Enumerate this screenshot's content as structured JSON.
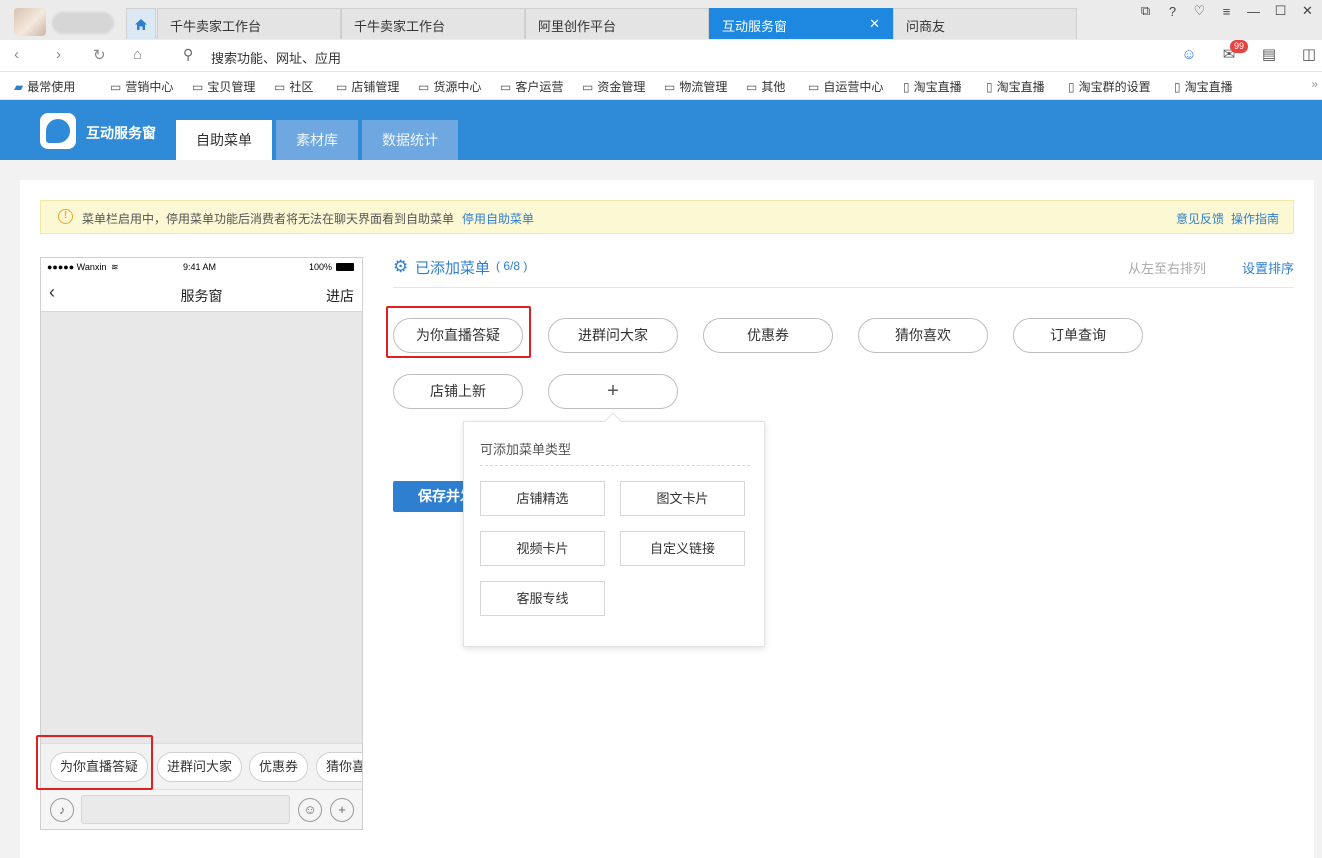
{
  "browser": {
    "tabs": [
      "千牛卖家工作台",
      "千牛卖家工作台",
      "阿里创作平台",
      "互动服务窗",
      "问商友"
    ],
    "active_tab": 3,
    "address_placeholder": "搜索功能、网址、应用",
    "mail_badge": "99",
    "bookmarks": [
      "最常使用",
      "营销中心",
      "宝贝管理",
      "社区",
      "店铺管理",
      "货源中心",
      "客户运营",
      "资金管理",
      "物流管理",
      "其他",
      "自运营中心",
      "淘宝直播",
      "淘宝直播",
      "淘宝群的设置",
      "淘宝直播"
    ],
    "bookmarks_more": "»"
  },
  "app": {
    "title": "互动服务窗",
    "tabs": [
      "自助菜单",
      "素材库",
      "数据统计"
    ],
    "active_tab": 0
  },
  "notice": {
    "text": "菜单栏启用中，停用菜单功能后消费者将无法在聊天界面看到自助菜单",
    "disable_link": "停用自助菜单",
    "feedback_link": "意见反馈",
    "guide_link": "操作指南"
  },
  "phone": {
    "carrier": "●●●●● Wanxin",
    "time": "9:41 AM",
    "battery": "100%",
    "title": "服务窗",
    "right_action": "进店",
    "menu_buttons": [
      "为你直播答疑",
      "进群问大家",
      "优惠券",
      "猜你喜欢"
    ]
  },
  "menus": {
    "title": "已添加菜单",
    "count": "( 6/8 )",
    "order_hint": "从左至右排列",
    "order_link": "设置排序",
    "items": [
      "为你直播答疑",
      "进群问大家",
      "优惠券",
      "猜你喜欢",
      "订单查询",
      "店铺上新"
    ],
    "add_label": "+",
    "save_label": "保存并发布"
  },
  "popover": {
    "title": "可添加菜单类型",
    "options": [
      "店铺精选",
      "图文卡片",
      "视频卡片",
      "自定义链接",
      "客服专线"
    ]
  },
  "colors": {
    "brand_blue": "#2f8ad8",
    "link_blue": "#2f7fd0",
    "highlight_red": "#e02020",
    "notice_bg": "#fdf8d4"
  }
}
